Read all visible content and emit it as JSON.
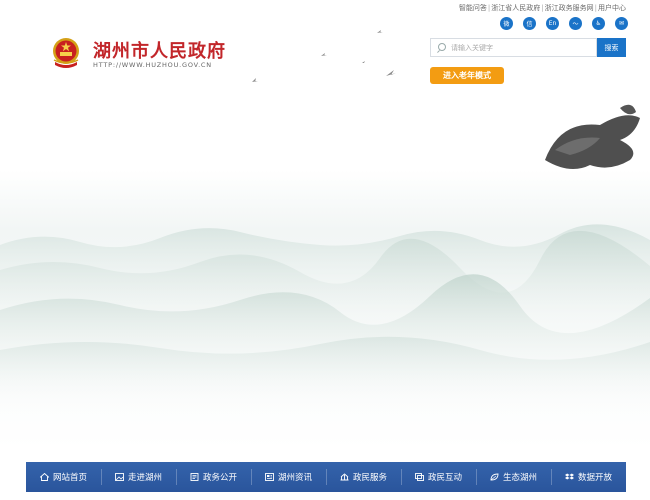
{
  "top_links": [
    "智能问答",
    "浙江省人民政府",
    "浙江政务服务网",
    "用户中心"
  ],
  "social_icons": [
    {
      "name": "weibo-icon",
      "glyph": "微"
    },
    {
      "name": "wechat-icon",
      "glyph": "信"
    },
    {
      "name": "english-icon",
      "glyph": "En"
    },
    {
      "name": "rss-icon",
      "glyph": "〜"
    },
    {
      "name": "accessibility-icon",
      "glyph": "♿"
    },
    {
      "name": "mail-icon",
      "glyph": "✉"
    }
  ],
  "site": {
    "title": "湖州市人民政府",
    "url": "HTTP://WWW.HUZHOU.GOV.CN"
  },
  "search": {
    "placeholder": "请输入关键字",
    "button": "搜索"
  },
  "elder_mode": "进入老年模式",
  "nav": [
    {
      "label": "网站首页",
      "icon": "home-icon"
    },
    {
      "label": "走进湖州",
      "icon": "picture-icon"
    },
    {
      "label": "政务公开",
      "icon": "document-icon"
    },
    {
      "label": "湖州资讯",
      "icon": "news-icon"
    },
    {
      "label": "政民服务",
      "icon": "service-icon"
    },
    {
      "label": "政民互动",
      "icon": "interact-icon"
    },
    {
      "label": "生态湖州",
      "icon": "leaf-icon"
    },
    {
      "label": "数据开放",
      "icon": "dropbox-icon"
    }
  ],
  "colors": {
    "brand_red": "#c2262a",
    "nav_blue": "#2f5ea6",
    "search_blue": "#1a73c8",
    "elder_orange": "#f39c12"
  }
}
